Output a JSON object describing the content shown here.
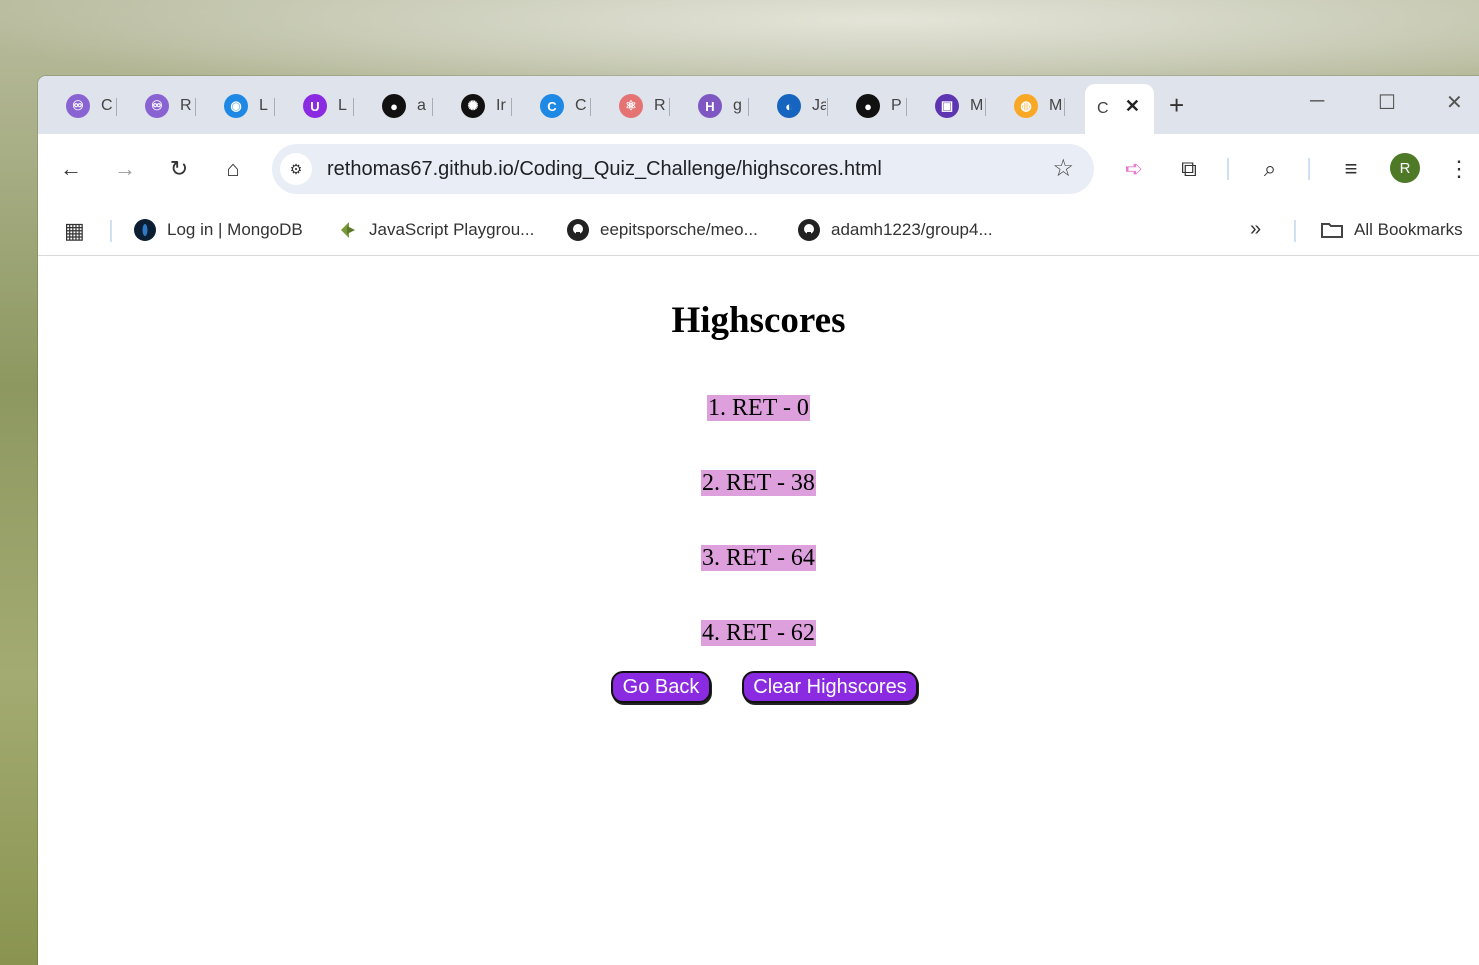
{
  "browser": {
    "tabs": [
      {
        "label": "C",
        "icon": "redux-icon",
        "color": "#8a63d2"
      },
      {
        "label": "R",
        "icon": "redux-icon",
        "color": "#8a63d2"
      },
      {
        "label": "L",
        "icon": "badge-icon",
        "color": "#1e88e5"
      },
      {
        "label": "L",
        "icon": "u-logo-icon",
        "color": "#8a2be2"
      },
      {
        "label": "a",
        "icon": "github-icon",
        "color": "#111111"
      },
      {
        "label": "Ir",
        "icon": "openai-icon",
        "color": "#111111"
      },
      {
        "label": "C",
        "icon": "c-logo-icon",
        "color": "#1e88e5"
      },
      {
        "label": "R",
        "icon": "react-icon",
        "color": "#e57373"
      },
      {
        "label": "g",
        "icon": "h-logo-icon",
        "color": "#7e57c2"
      },
      {
        "label": "Ja",
        "icon": "globe-icon",
        "color": "#1565c0"
      },
      {
        "label": "P",
        "icon": "person-icon",
        "color": "#111111"
      },
      {
        "label": "M",
        "icon": "purple-badge-icon",
        "color": "#5e35b1"
      },
      {
        "label": "M",
        "icon": "orange-badge-icon",
        "color": "#f9a825"
      }
    ],
    "active_tab": {
      "label": "C",
      "close": "✕"
    },
    "new_tab": "+",
    "url": "rethomas67.github.io/Coding_Quiz_Challenge/highscores.html",
    "profile_initial": "R",
    "bookmarks": [
      {
        "label": "Log in | MongoDB",
        "icon": "mongodb-icon"
      },
      {
        "label": "JavaScript Playgrou...",
        "icon": "playground-icon"
      },
      {
        "label": "eepitsporsche/meo...",
        "icon": "github-icon"
      },
      {
        "label": "adamh1223/group4...",
        "icon": "github-icon"
      }
    ],
    "bookmarks_overflow": "»",
    "all_bookmarks": "All Bookmarks"
  },
  "page": {
    "title": "Highscores",
    "scores": [
      "1. RET - 0",
      "2. RET - 38",
      "3. RET - 64",
      "4. RET - 62"
    ],
    "go_back": "Go Back",
    "clear": "Clear Highscores",
    "highlight_color": "#dda0dd",
    "button_color": "#8a2be2"
  }
}
